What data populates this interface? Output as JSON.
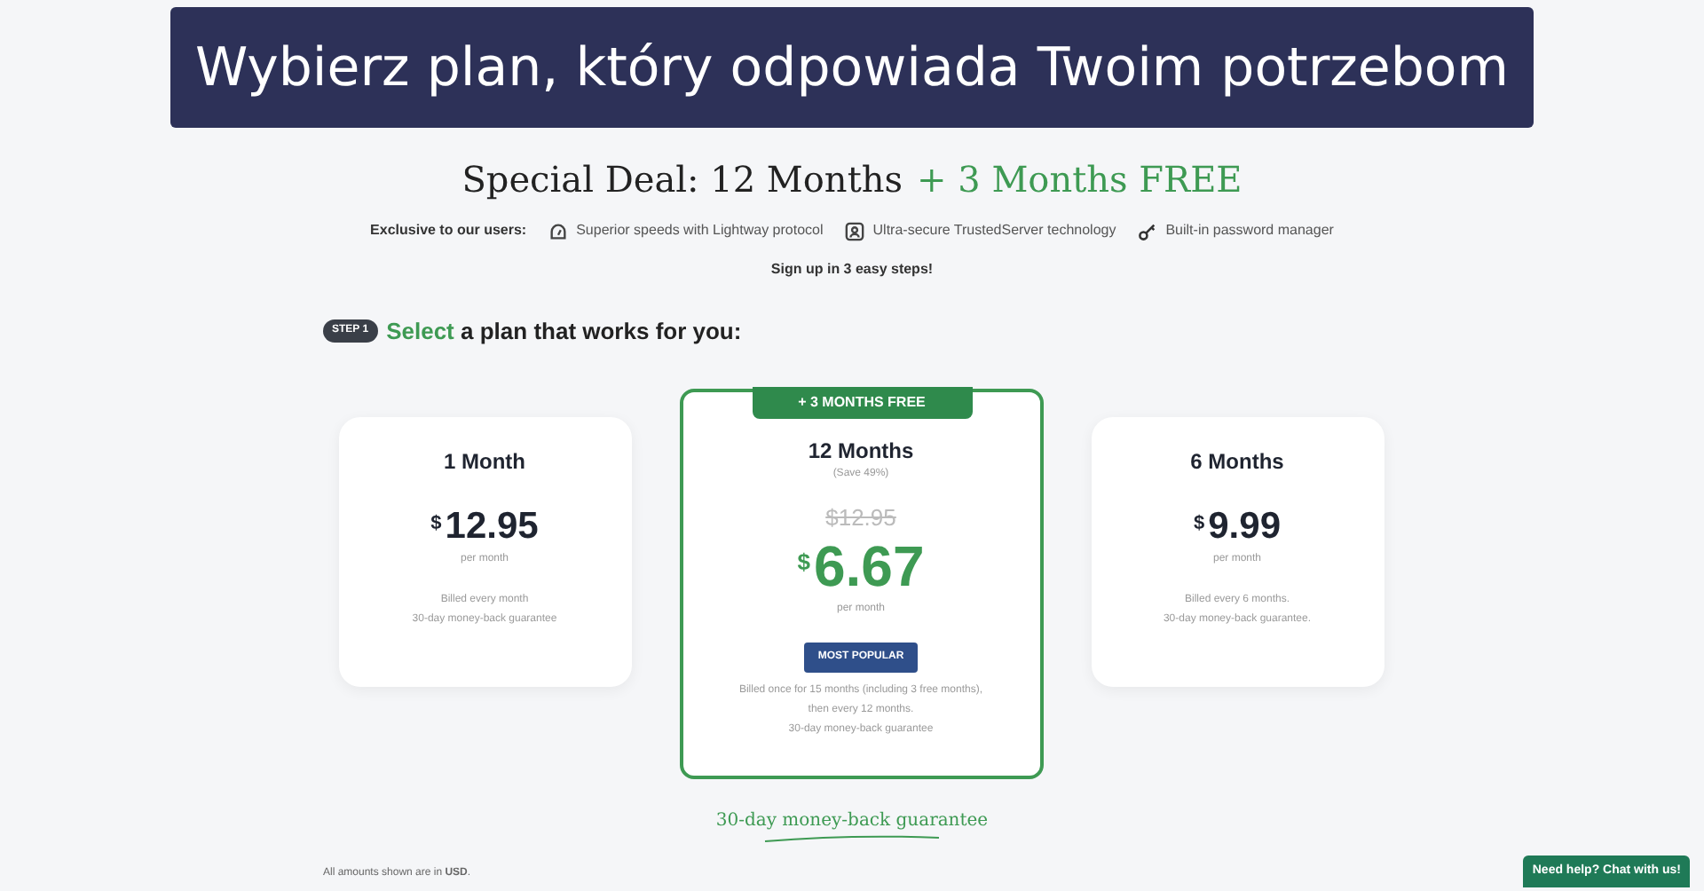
{
  "banner": {
    "title": "Wybierz plan, który odpowiada Twoim potrzebom"
  },
  "headline": {
    "main": "Special Deal: 12 Months",
    "accent": "+ 3 Months FREE"
  },
  "features": {
    "label": "Exclusive to our users:",
    "items": [
      {
        "kind": "speed",
        "text": "Superior speeds with Lightway protocol"
      },
      {
        "kind": "server",
        "text": "Ultra-secure TrustedServer technology"
      },
      {
        "kind": "key",
        "text": "Built-in password manager"
      }
    ]
  },
  "signup": "Sign up in 3 easy steps!",
  "step": {
    "badge": "STEP 1",
    "accent": "Select",
    "text": "a plan that works for you:"
  },
  "plans": [
    {
      "name": "1 Month",
      "selected": false,
      "currency": "$",
      "price": "12.95",
      "period": "per month",
      "notes": [
        "Billed every month",
        "30-day money-back guarantee"
      ]
    },
    {
      "name": "12 Months",
      "selected": true,
      "ribbon": "+ 3 MONTHS FREE",
      "save": "(Save 49%)",
      "old_price": "$12.95",
      "currency": "$",
      "price": "6.67",
      "period": "per month",
      "tag": "MOST POPULAR",
      "notes": [
        "Billed once for 15 months (including 3 free months),",
        "then every 12 months.",
        "30-day money-back guarantee"
      ]
    },
    {
      "name": "6 Months",
      "selected": false,
      "currency": "$",
      "price": "9.99",
      "period": "per month",
      "notes": [
        "Billed every 6 months.",
        "30-day money-back guarantee."
      ]
    }
  ],
  "guarantee": "30-day money-back guarantee",
  "footnote": "All amounts shown are in **USD**.",
  "chat_button": "Need help? Chat with us!"
}
